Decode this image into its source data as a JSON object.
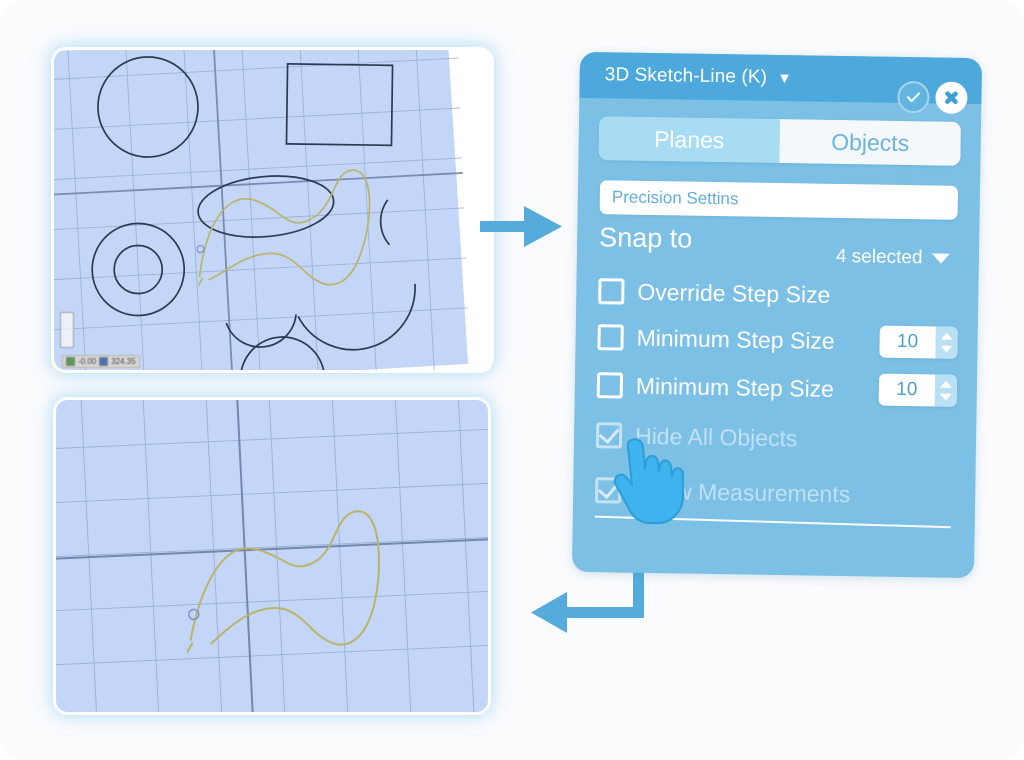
{
  "page": {
    "background_color": "#fafbfd"
  },
  "colors": {
    "accent_blue": "#4da8dc",
    "dialog_body": "#7cc0e6",
    "tab_active": "#a8dcf2",
    "tab_inactive_text": "#6ab3e0",
    "canvas_fill": "#c3d6f7",
    "sketch_stroke": "#2b3a52",
    "spline_stroke": "#b9b46a",
    "arrow_blue": "#56abdd",
    "white": "#ffffff"
  },
  "canvas_top": {
    "name": "sketch-viewport-all-objects",
    "coord_readout": {
      "x_value": "-0.00",
      "y_value": "324.35"
    },
    "shapes": [
      "circle-large",
      "rectangle",
      "ellipse",
      "annulus-outer-circle",
      "annulus-inner-circle",
      "arc-right",
      "arc-bottom-left",
      "arc-bottom-right",
      "circle-bottom",
      "spline-curve"
    ]
  },
  "canvas_bottom": {
    "name": "sketch-viewport-objects-hidden",
    "shapes": [
      "spline-curve"
    ]
  },
  "arrows": {
    "to_dialog": "arrow-right",
    "from_dialog": "arrow-return-left"
  },
  "dialog": {
    "title": "3D Sketch-Line (K)",
    "title_caret": "▼",
    "buttons": {
      "ok_label": "OK",
      "ok_icon": "checkmark-icon",
      "close_label": "Close",
      "close_icon": "close-x-icon"
    },
    "tabs": [
      {
        "label": "Planes",
        "active": true
      },
      {
        "label": "Objects",
        "active": false
      }
    ],
    "precision_combo": {
      "value": "Precision Settins",
      "placeholder": "Precision Settins"
    },
    "snap_to": {
      "label": "Snap to",
      "selection_value": "4 selected"
    },
    "checkboxes": [
      {
        "label": "Override Step Size",
        "checked": false,
        "disabled": false,
        "has_spinner": false,
        "spinner_value": ""
      },
      {
        "label": "Minimum Step Size",
        "checked": false,
        "disabled": false,
        "has_spinner": true,
        "spinner_value": "10"
      },
      {
        "label": "Minimum Step Size",
        "checked": false,
        "disabled": false,
        "has_spinner": true,
        "spinner_value": "10"
      },
      {
        "label": "Hide All Objects",
        "checked": true,
        "disabled": true,
        "has_spinner": false,
        "spinner_value": ""
      },
      {
        "label": "Show Measurements",
        "checked": true,
        "disabled": true,
        "has_spinner": false,
        "spinner_value": ""
      }
    ]
  },
  "cursor": {
    "type": "pointing-hand-cursor"
  }
}
